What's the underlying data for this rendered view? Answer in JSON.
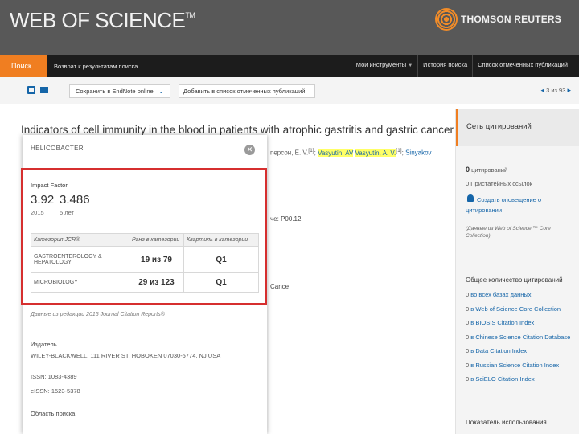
{
  "header": {
    "logo_text": "WEB OF SCIENCE",
    "logo_tm": "TM",
    "brand_text": "THOMSON REUTERS"
  },
  "nav": {
    "search": "Поиск",
    "back": "Возврат к результатам поиска",
    "my_tools": "Мои инструменты",
    "history": "История поиска",
    "marked_list": "Список отмеченных публикаций"
  },
  "toolbar": {
    "endnote": "Сохранить в EndNote online",
    "add_marked": "Добавить в список отмеченных публикаций",
    "pager": "3 из 93"
  },
  "article": {
    "title": "Indicators of cell immunity in the blood in patients with atrophic gastritis and gastric cancer",
    "authors_prefix": "персон, Е. V.",
    "sup1": "[1]",
    "author_hl": "Vasyutin, AV",
    "author_hl2": "Vasyutin, A. V.",
    "sup2": "[1]",
    "author_next": "Sinyakov",
    "meta_fragment": "че: P00.12",
    "meta_fragment2": "Cance"
  },
  "popup": {
    "title": "HELICOBACTER",
    "impact_factor_label": "Impact Factor",
    "if_value": "3.92",
    "if5_value": "3.486",
    "if_year": "2015",
    "if5_label": "5 лет",
    "table_headers": [
      "Категория JCR®",
      "Ранг в категории",
      "Квартиль в категории"
    ],
    "rows": [
      {
        "category": "GASTROENTEROLOGY & HEPATOLOGY",
        "rank": "19 из 79",
        "quartile": "Q1"
      },
      {
        "category": "MICROBIOLOGY",
        "rank": "29 из 123",
        "quartile": "Q1"
      }
    ],
    "jcr_note": "Данные из редакции 2015 Journal Citation Reports®",
    "publisher_label": "Издатель",
    "publisher_value": "WILEY-BLACKWELL, 111 RIVER ST, HOBOKEN 07030-5774, NJ USA",
    "issn": "ISSN: 1083-4389",
    "eissn": "eISSN: 1523-5378",
    "area_label": "Область поиска"
  },
  "sidebar": {
    "title": "Сеть цитирований",
    "cited_count": "0",
    "cited_label": "цитирований",
    "refs": "0 Пристатейных ссылок",
    "create_alert": "Создать оповещение о цитировании",
    "alert_note": "(Данные из Web of Science ™ Core Collection)",
    "total_title": "Общее количество цитирований",
    "db_list": [
      {
        "n": "0",
        "label": "в All Databases",
        "label_ru": "во всех базах данных"
      },
      {
        "n": "0",
        "label": "в Web of Science Core Collection"
      },
      {
        "n": "0",
        "label": "в BIOSIS Citation Index"
      },
      {
        "n": "0",
        "label": "в Chinese Science Citation Database"
      },
      {
        "n": "0",
        "label": "в Data Citation Index"
      },
      {
        "n": "0",
        "label": "в Russian Science Citation Index"
      },
      {
        "n": "0",
        "label": "в SciELO Citation Index"
      }
    ],
    "usage_title": "Показатель использования"
  }
}
